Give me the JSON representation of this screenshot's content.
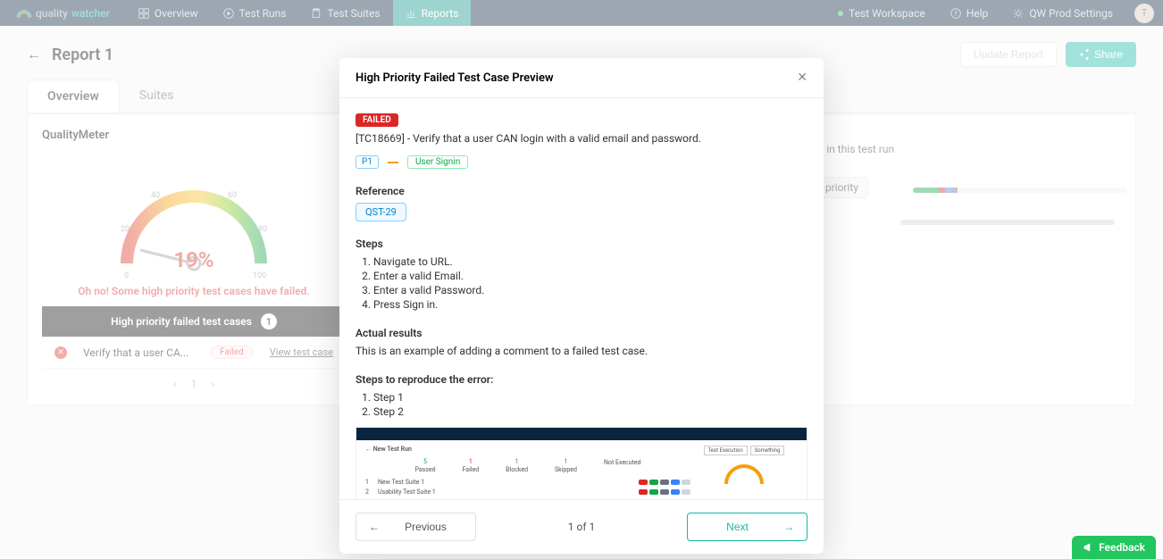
{
  "brand": {
    "name_a": "quality",
    "name_b": "watcher"
  },
  "nav": {
    "items": [
      {
        "label": "Overview"
      },
      {
        "label": "Test Runs"
      },
      {
        "label": "Test Suites"
      },
      {
        "label": "Reports"
      }
    ],
    "workspace": "Test Workspace",
    "help": "Help",
    "settings": "QW Prod Settings",
    "avatar_initial": "T"
  },
  "page": {
    "title": "Report 1",
    "update_btn": "Update Report",
    "share_btn": "Share",
    "tabs": [
      {
        "label": "Overview"
      },
      {
        "label": "Suites"
      }
    ]
  },
  "gauge": {
    "title": "QualityMeter",
    "ticks": [
      "0",
      "20",
      "40",
      "60",
      "80",
      "100"
    ],
    "percent": "19%",
    "message": "Oh no! Some high priority test cases have failed."
  },
  "failed_bar": {
    "label": "High priority failed test cases",
    "count": "1"
  },
  "failed_row": {
    "name": "Verify that a user CA...",
    "badge": "Failed",
    "link": "View test case"
  },
  "right_panel": {
    "run_text": "al in this test run",
    "priority_label": "priority"
  },
  "small_pager": {
    "page": "1"
  },
  "modal": {
    "title": "High Priority Failed Test Case Preview",
    "status": "FAILED",
    "tc_title": "[TC18669] - Verify that a user CAN login with a valid email and password.",
    "p_tag": "P1",
    "suite_tag": "User Signin",
    "reference_h": "Reference",
    "reference": "QST-29",
    "steps_h": "Steps",
    "steps": [
      "Navigate to URL.",
      "Enter a valid Email.",
      "Enter a valid Password.",
      "Press Sign in."
    ],
    "actual_h": "Actual results",
    "actual_text": "This is an example of adding a comment to a failed test case.",
    "repro_h": "Steps to reproduce the error:",
    "repro_steps": [
      "Step 1",
      "Step 2"
    ],
    "prev": "Previous",
    "next": "Next",
    "page_of": "1 of 1"
  },
  "attachment": {
    "title": "New Test Run",
    "stats": [
      {
        "n": "5",
        "l": "Passed",
        "c": "#16a34a"
      },
      {
        "n": "1",
        "l": "Failed",
        "c": "#dc2626"
      },
      {
        "n": "1",
        "l": "Blocked",
        "c": "#6b7280"
      },
      {
        "n": "1",
        "l": "Skipped",
        "c": "#3b82f6"
      },
      {
        "n": "",
        "l": "Not Executed",
        "c": "#6b7280"
      }
    ],
    "rows": [
      "New Test Suite 1",
      "Usability Test Suite 1"
    ],
    "right_btns": [
      "Test Execution",
      "Something"
    ]
  },
  "feedback": "Feedback",
  "chart_data": {
    "type": "gauge",
    "title": "QualityMeter",
    "value": 19,
    "min": 0,
    "max": 100,
    "ticks": [
      0,
      20,
      40,
      60,
      80,
      100
    ],
    "status_message": "Oh no! Some high priority test cases have failed.",
    "color_stops": [
      {
        "pct": 0,
        "color": "#d93025"
      },
      {
        "pct": 25,
        "color": "#f59e0b"
      },
      {
        "pct": 50,
        "color": "#fbbf24"
      },
      {
        "pct": 75,
        "color": "#84cc16"
      },
      {
        "pct": 100,
        "color": "#16a34a"
      }
    ]
  }
}
